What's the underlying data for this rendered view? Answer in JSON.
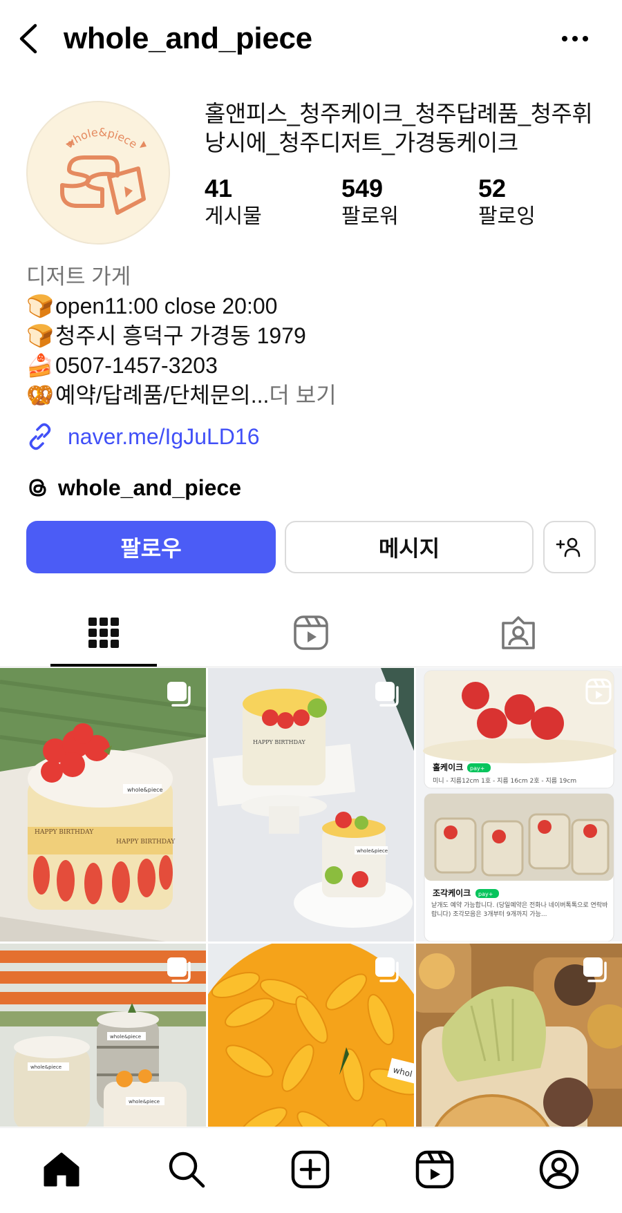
{
  "header": {
    "username": "whole_and_piece"
  },
  "avatar": {
    "logo_text": "whole&piece"
  },
  "profile": {
    "display_name": "홀앤피스_청주케이크_청주답례품_청주휘낭시에_청주디저트_가경동케이크",
    "stats": [
      {
        "value": "41",
        "label": "게시물"
      },
      {
        "value": "549",
        "label": "팔로워"
      },
      {
        "value": "52",
        "label": "팔로잉"
      }
    ]
  },
  "bio": {
    "category": "디저트 가게",
    "lines": [
      {
        "emoji": "🍞",
        "text": "open11:00 close 20:00"
      },
      {
        "emoji": "🍞",
        "text": "청주시 흥덕구 가경동 1979"
      },
      {
        "emoji": "🍰",
        "text": "0507-1457-3203"
      },
      {
        "emoji": "🥨",
        "text": "예약/답례품/단체문의...",
        "more": " 더 보기"
      }
    ],
    "link": "naver.me/IgJuLD16"
  },
  "threads": {
    "handle": "whole_and_piece"
  },
  "actions": {
    "follow_label": "팔로우",
    "message_label": "메시지"
  },
  "tabs": [
    "grid-icon",
    "reels-icon",
    "tagged-icon"
  ],
  "posts": {
    "p1_labels": [
      "whole&piece",
      "HAPPY BIRTHDAY",
      "HAPPY BIRTHDAY"
    ],
    "p2_labels": [
      "HAPPY BIRTHDAY",
      "whole&piece"
    ],
    "p3": {
      "card1_title": "홀케이크",
      "card1_badge": "pay+",
      "card1_desc": "미니 - 지름12cm 1호 - 지름 16cm 2호 - 지름 19cm",
      "card2_title": "조각케이크",
      "card2_badge": "pay+",
      "card2_desc": "낱개도 예약 가능합니다. (당일예약은 전화나 네이버톡톡으로 연락바랍니다) 조각모음은 3개부터 9개까지 가능..."
    },
    "p4_labels": [
      "whole&piece",
      "whole&piece",
      "whole&piece"
    ],
    "p5_labels": [
      "whol"
    ]
  },
  "bottom_nav": [
    "home-icon",
    "search-icon",
    "create-icon",
    "reels-icon",
    "profile-icon"
  ],
  "colors": {
    "accent": "#4b5cf6",
    "link": "#4150f7",
    "muted": "#737373",
    "logo": "#e58a5f"
  }
}
